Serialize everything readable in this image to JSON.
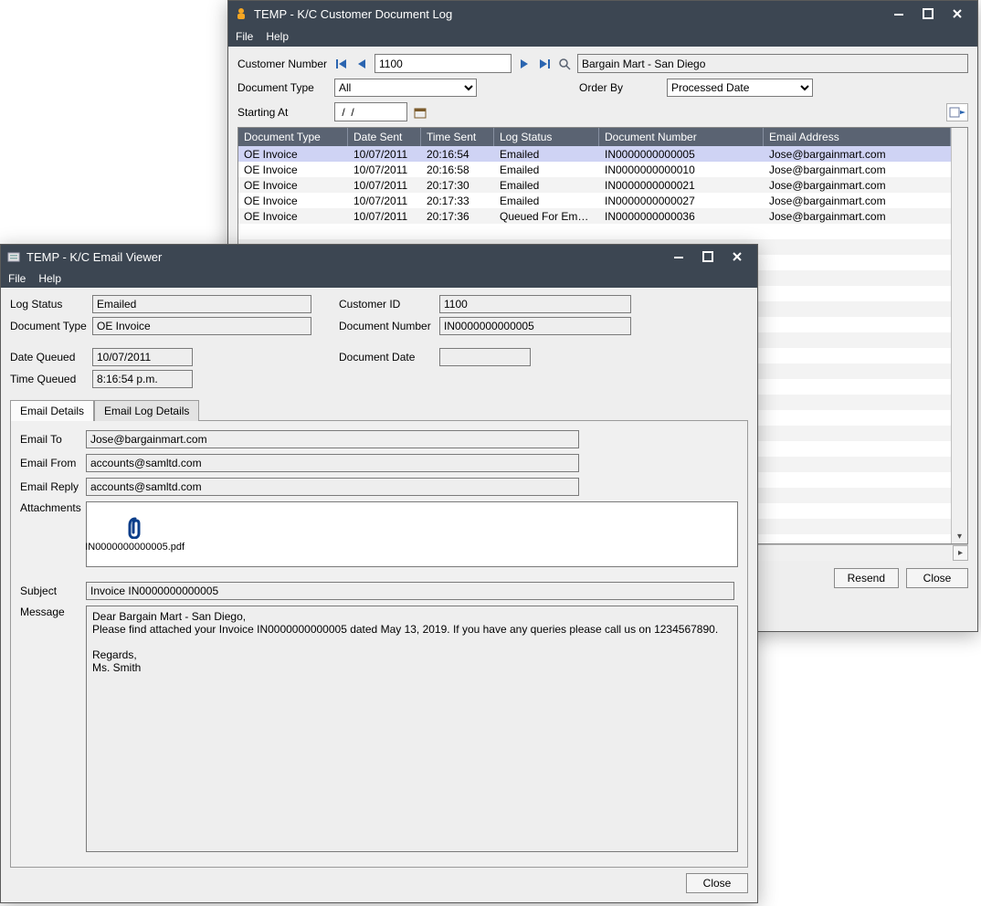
{
  "log_window": {
    "title": "TEMP - K/C Customer Document Log",
    "menu": {
      "file": "File",
      "help": "Help"
    },
    "labels": {
      "customer_number": "Customer Number",
      "document_type": "Document Type",
      "starting_at": "Starting At",
      "order_by": "Order By"
    },
    "customer_number": "1100",
    "customer_name": "Bargain Mart - San Diego",
    "doc_type_selected": "All",
    "order_by_selected": "Processed Date",
    "starting_at": " /  /",
    "columns": {
      "doc_type": "Document Type",
      "date_sent": "Date Sent",
      "time_sent": "Time Sent",
      "log_status": "Log Status",
      "doc_number": "Document Number",
      "email": "Email Address"
    },
    "rows": [
      {
        "doc_type": "OE Invoice",
        "date_sent": "10/07/2011",
        "time_sent": "20:16:54",
        "log_status": "Emailed",
        "doc_number": "IN0000000000005",
        "email": "Jose@bargainmart.com",
        "selected": true
      },
      {
        "doc_type": "OE Invoice",
        "date_sent": "10/07/2011",
        "time_sent": "20:16:58",
        "log_status": "Emailed",
        "doc_number": "IN0000000000010",
        "email": "Jose@bargainmart.com"
      },
      {
        "doc_type": "OE Invoice",
        "date_sent": "10/07/2011",
        "time_sent": "20:17:30",
        "log_status": "Emailed",
        "doc_number": "IN0000000000021",
        "email": "Jose@bargainmart.com"
      },
      {
        "doc_type": "OE Invoice",
        "date_sent": "10/07/2011",
        "time_sent": "20:17:33",
        "log_status": "Emailed",
        "doc_number": "IN0000000000027",
        "email": "Jose@bargainmart.com"
      },
      {
        "doc_type": "OE Invoice",
        "date_sent": "10/07/2011",
        "time_sent": "20:17:36",
        "log_status": "Queued For Emailing",
        "doc_number": "IN0000000000036",
        "email": "Jose@bargainmart.com"
      }
    ],
    "buttons": {
      "resend": "Resend",
      "close": "Close"
    }
  },
  "ev_window": {
    "title": "TEMP - K/C Email Viewer",
    "menu": {
      "file": "File",
      "help": "Help"
    },
    "labels": {
      "log_status": "Log Status",
      "document_type": "Document Type",
      "date_queued": "Date Queued",
      "time_queued": "Time Queued",
      "customer_id": "Customer ID",
      "document_number": "Document Number",
      "document_date": "Document Date"
    },
    "log_status": "Emailed",
    "document_type": "OE Invoice",
    "date_queued": "10/07/2011",
    "time_queued": "8:16:54 p.m.",
    "customer_id": "1100",
    "document_number": "IN0000000000005",
    "document_date": "",
    "tabs": {
      "details": "Email Details",
      "log": "Email Log Details"
    },
    "detail_labels": {
      "to": "Email To",
      "from": "Email From",
      "reply": "Email Reply",
      "attachments": "Attachments",
      "subject": "Subject",
      "message": "Message"
    },
    "to": "Jose@bargainmart.com",
    "from": "accounts@samltd.com",
    "reply": "accounts@samltd.com",
    "attachment_name": "IN0000000000005.pdf",
    "subject": "Invoice IN0000000000005",
    "message": "Dear Bargain Mart - San Diego,\n   Please find attached your Invoice IN0000000000005 dated May 13, 2019.  If you have any queries please call us on 1234567890.\n\nRegards,\nMs. Smith",
    "buttons": {
      "close": "Close"
    }
  }
}
